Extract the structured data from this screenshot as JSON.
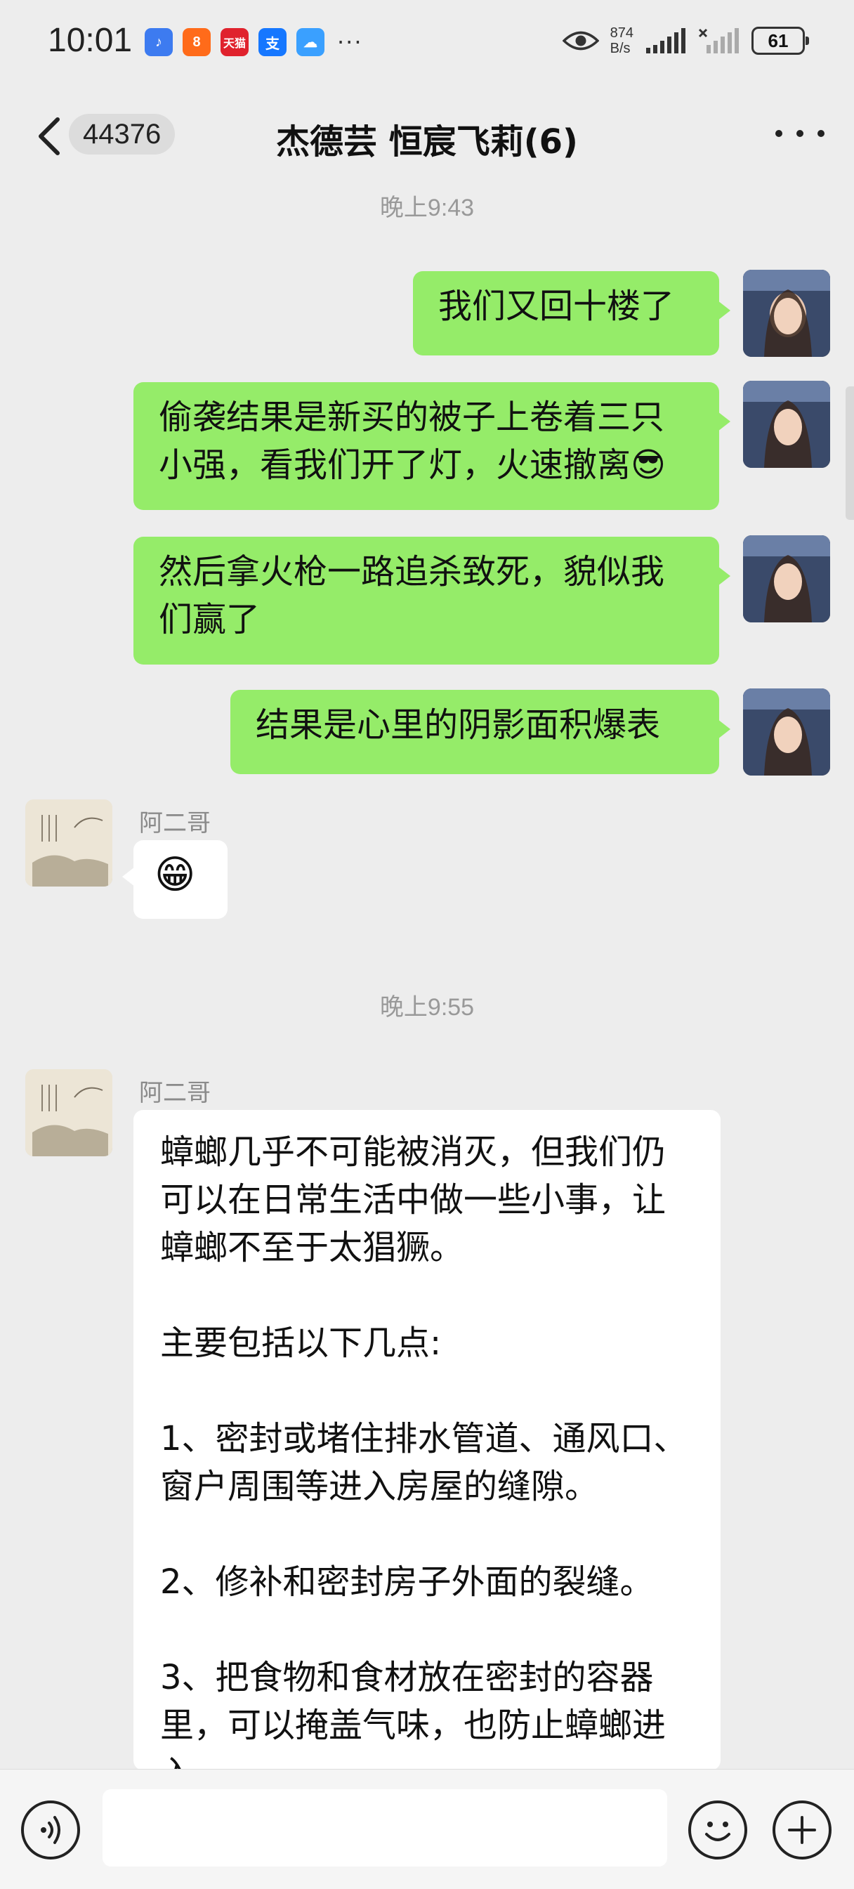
{
  "status_bar": {
    "time": "10:01",
    "app_icons": [
      {
        "icon": "qq-music-icon",
        "label": "♪",
        "color": "#3d7bf0"
      },
      {
        "icon": "app-icon-88",
        "label": "8",
        "color": "#ff6b1a"
      },
      {
        "icon": "tmall-icon",
        "label": "天猫",
        "color": "#e0222d"
      },
      {
        "icon": "alipay-icon",
        "label": "支",
        "color": "#1677ff"
      },
      {
        "icon": "weather-icon",
        "label": "☁",
        "color": "#3aa0ff"
      }
    ],
    "more": "···",
    "net_speed_value": "874",
    "net_speed_unit": "B/s",
    "battery": "61"
  },
  "header": {
    "unread_count": "44376",
    "title": "杰德芸 恒宸飞莉(6)"
  },
  "messages": {
    "time_1": "晚上9:43",
    "me_1": "我们又回十楼了",
    "me_2": "偷袭结果是新买的被子上卷着三只小强，看我们开了灯，火速撤离😎",
    "me_3": "然后拿火枪一路追杀致死，貌似我们赢了",
    "me_4": "结果是心里的阴影面积爆表",
    "other_1_sender": "阿二哥",
    "other_1_text": "😁",
    "time_2": "晚上9:55",
    "other_2_sender": "阿二哥",
    "other_2_text": "蟑螂几乎不可能被消灭，但我们仍可以在日常生活中做一些小事，让蟑螂不至于太猖獗。\n\n主要包括以下几点:\n\n1、密封或堵住排水管道、通风口、窗户周围等进入房屋的缝隙。\n\n2、修补和密封房子外面的裂缝。\n\n3、把食物和食材放在密封的容器里，可以掩盖气味，也防止蟑螂进入"
  },
  "input_bar": {
    "placeholder": ""
  }
}
